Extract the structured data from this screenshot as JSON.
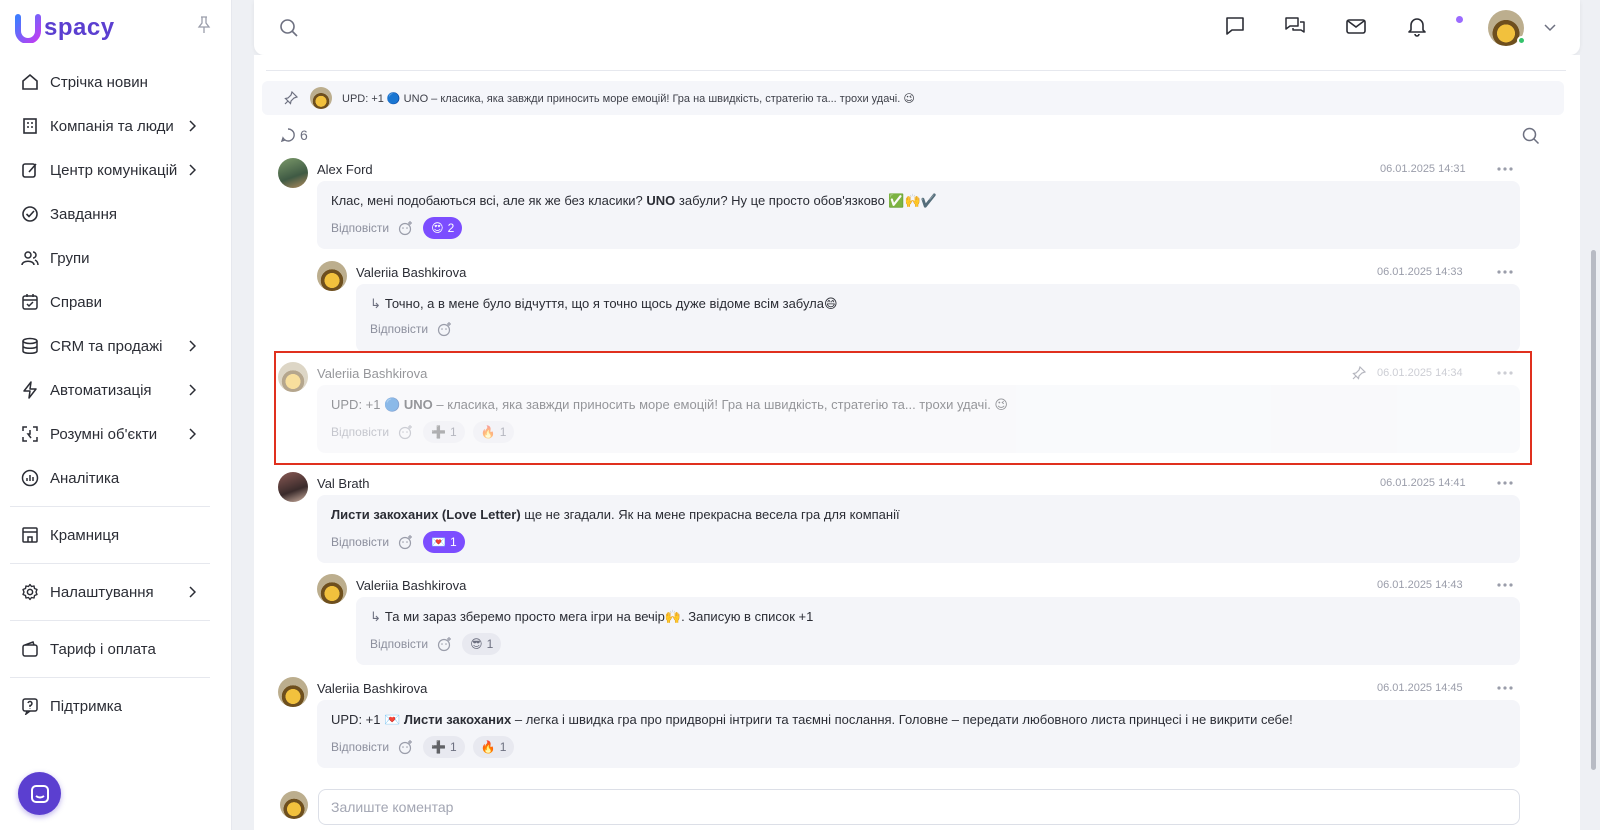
{
  "app": {
    "logo_text": "spacy",
    "brand_color": "#5b3fd0"
  },
  "sidebar": {
    "items": [
      {
        "label": "Стрічка новин",
        "icon": "home-icon",
        "chevron": false
      },
      {
        "label": "Компанія та люди",
        "icon": "building-icon",
        "chevron": true
      },
      {
        "label": "Центр комунікацій",
        "icon": "edit-chat-icon",
        "chevron": true
      },
      {
        "label": "Завдання",
        "icon": "check-circle-icon",
        "chevron": false
      },
      {
        "label": "Групи",
        "icon": "users-icon",
        "chevron": false
      },
      {
        "label": "Справи",
        "icon": "calendar-icon",
        "chevron": false
      },
      {
        "label": "CRM та продажі",
        "icon": "coins-icon",
        "chevron": true
      },
      {
        "label": "Автоматизація",
        "icon": "lightning-icon",
        "chevron": true
      },
      {
        "label": "Розумні об'єкти",
        "icon": "smart-object-icon",
        "chevron": true
      },
      {
        "label": "Аналітика",
        "icon": "analytics-icon",
        "chevron": false
      },
      {
        "label": "Крамниця",
        "icon": "store-icon",
        "chevron": false
      },
      {
        "label": "Налаштування",
        "icon": "gear-icon",
        "chevron": true
      },
      {
        "label": "Тариф і оплата",
        "icon": "wallet-icon",
        "chevron": false
      },
      {
        "label": "Підтримка",
        "icon": "help-icon",
        "chevron": false
      }
    ]
  },
  "pinned": {
    "text": "UPD: +1 🔵 UNO – класика, яка завжди приносить море емоцій! Гра на швидкість, стратегію та... трохи удачі. 😉"
  },
  "comments_header": {
    "count": "6"
  },
  "comments": [
    {
      "author": "Alex Ford",
      "date": "06.01.2025 14:31",
      "text_pre": "Клас, мені подобаються всі, але як же без класики? ",
      "text_bold": "UNO",
      "text_post": " забули? Ну це просто обов'язково ✅🙌✔️",
      "reply_label": "Відповісти",
      "reactions": [
        {
          "emoji": "😍",
          "count": "2",
          "style": "purple"
        }
      ]
    },
    {
      "author": "Valeriia Bashkirova",
      "date": "06.01.2025 14:33",
      "text": "Точно, а в мене було відчуття, що я точно щось дуже відоме всім забула😄",
      "reply_label": "Відповісти",
      "reactions": []
    },
    {
      "author": "Valeriia Bashkirova",
      "date": "06.01.2025 14:34",
      "text_pre": "UPD: +1 🔵 ",
      "text_bold": "UNO",
      "text_post": "  – класика, яка завжди приносить море емоцій! Гра на швидкість, стратегію та... трохи удачі. 😉",
      "reply_label": "Відповісти",
      "reactions": [
        {
          "emoji": "➕",
          "count": "1",
          "style": "grey"
        },
        {
          "emoji": "🔥",
          "count": "1",
          "style": "grey"
        }
      ]
    },
    {
      "author": "Val Brath",
      "date": "06.01.2025 14:41",
      "text_bold": "Листи закоханих (Love Letter)",
      "text_post": " ще не згадали. Як на мене прекрасна весела гра для компанії",
      "reply_label": "Відповісти",
      "reactions": [
        {
          "emoji": "💌",
          "count": "1",
          "style": "purple"
        }
      ]
    },
    {
      "author": "Valeriia Bashkirova",
      "date": "06.01.2025 14:43",
      "text": "Та ми зараз зберемо просто мега ігри на вечір🙌. Записую в список +1",
      "reply_label": "Відповісти",
      "reactions": [
        {
          "emoji": "😎",
          "count": "1",
          "style": "grey"
        }
      ]
    },
    {
      "author": "Valeriia Bashkirova",
      "date": "06.01.2025 14:45",
      "text_pre": "UPD: +1 💌 ",
      "text_bold": "Листи закоханих",
      "text_post": " – легка і швидка гра про придворні інтриги та таємні послання. Головне – передати любовного листа принцесі і не викрити себе!",
      "reply_label": "Відповісти",
      "reactions": [
        {
          "emoji": "➕",
          "count": "1",
          "style": "grey"
        },
        {
          "emoji": "🔥",
          "count": "1",
          "style": "grey"
        }
      ]
    }
  ],
  "compose": {
    "placeholder": "Залиште коментар"
  }
}
